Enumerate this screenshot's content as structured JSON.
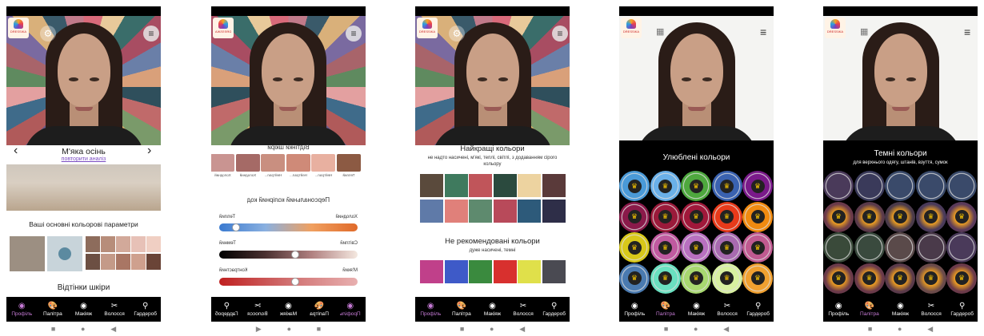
{
  "logo_text": "DRESSIKA",
  "icons": {
    "menu": "menu-icon",
    "settings": "gear-icon",
    "grid": "grid-icon",
    "crown": "crown-icon",
    "back": "chevron-left-icon",
    "forward": "chevron-right-icon"
  },
  "nav": {
    "profile": "Профіль",
    "palette": "Палітра",
    "makeup": "Макіяж",
    "hair": "Волосся",
    "wardrobe": "Гардероб"
  },
  "screen1": {
    "season": "М'яка осінь",
    "repeat_link": "повторити аналіз",
    "params_title": "Ваші основні кольорові параметри",
    "skin_title": "Відтінки шкіри",
    "param_colors": [
      "#8d6c5c",
      "#b78d7a",
      "#d2a99a",
      "#e7c1b7",
      "#f0cfc3",
      "#6c4f43",
      "#c49a88",
      "#a97664",
      "#cfa08e",
      "#6a4437"
    ]
  },
  "screen2": {
    "skin_title": "Відтінки шкіри",
    "skin_swatches": [
      {
        "label": "Теплий",
        "color": "#8c5a43"
      },
      {
        "label": "Нейтрал...",
        "color": "#e8b0a0"
      },
      {
        "label": "Нейтрал...",
        "color": "#cf8a78"
      },
      {
        "label": "Нейтрал...",
        "color": "#c98f80"
      },
      {
        "label": "Холодний",
        "color": "#a56a66"
      },
      {
        "label": "Холодний",
        "color": "#c99491"
      }
    ],
    "code_title": "Персональний колірний код",
    "slider1": {
      "left": "Холодний",
      "right": "Теплий",
      "value": 0.9
    },
    "slider2": {
      "left": "Світлий",
      "right": "Темний",
      "value": 0.45
    },
    "slider3": {
      "left": "М'який",
      "right": "Контрастний",
      "value": 0.45
    }
  },
  "screen3": {
    "best_title": "Найкращі кольори",
    "best_desc": "не надто насичені, м'які, теплі, світлі, з додаванням сірого кольору",
    "best_colors": [
      "#5a4a3c",
      "#3f7a5e",
      "#c0555a",
      "#2b4a3e",
      "#edd3a0",
      "#5a3a3a",
      "#5f7aa8",
      "#e0807a",
      "#5e8a6e",
      "#b84a5a",
      "#2d5a7a",
      "#2e2e48"
    ],
    "bad_title": "Не рекомендовані кольори",
    "bad_desc": "дуже насичені, темні",
    "bad_colors": [
      "#c0408a",
      "#3e5ac8",
      "#3a8a3e",
      "#d8302e",
      "#e0e04a",
      "#4a4a52"
    ]
  },
  "screen4": {
    "title": "Улюблені кольори",
    "circles": [
      "#4a9ad8",
      "#6ab0e8",
      "#4ea83e",
      "#3a62b0",
      "#7a1a8a",
      "#8a1a4a",
      "#9a1a3a",
      "#a0183a",
      "#e83a1a",
      "#f08a10",
      "#d8c81a",
      "#c05aa0",
      "#b870c0",
      "#a86ab0",
      "#c05a90",
      "#4a7ab0",
      "#6ae0c0",
      "#a8d870",
      "#d8f0a0",
      "#f0a030"
    ]
  },
  "screen5": {
    "title": "Темні кольори",
    "subtitle": "для верхнього одягу, штанів, взуття, сумок",
    "circles": [
      "#4a3a5a",
      "#3a3a5a",
      "#3a4a6a",
      "#3a4a6a",
      "#3a4a6a",
      "#6a3a4a",
      "#5a3a4a",
      "#4a3a4a",
      "#4a3a5a",
      "#5a3a5a",
      "#3a4a3a",
      "#3a4a3e",
      "#5a4a4a",
      "#4a3a4a",
      "#4a3a5a",
      "#6a3a4a",
      "#6a3a4a",
      "#5a3a4a",
      "#6a4a4a",
      "#6a3a4a"
    ]
  }
}
